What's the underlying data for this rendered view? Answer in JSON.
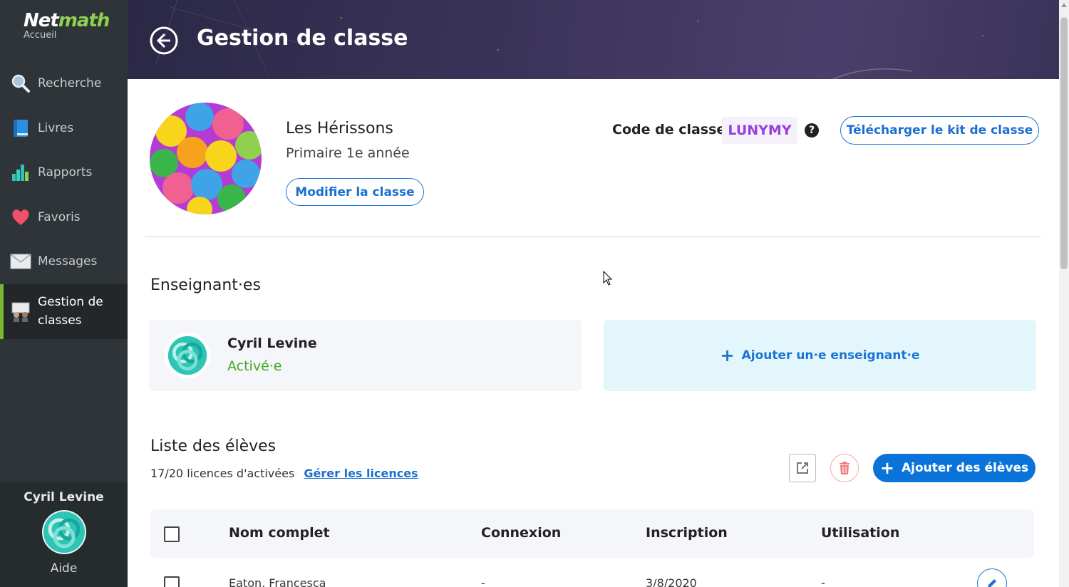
{
  "sidebar": {
    "brand_part1": "Net",
    "brand_part2": "math",
    "brand_sub": "Accueil",
    "items": [
      {
        "label": "Recherche",
        "icon": "search-icon"
      },
      {
        "label": "Livres",
        "icon": "book-icon"
      },
      {
        "label": "Rapports",
        "icon": "reports-icon"
      },
      {
        "label": "Favoris",
        "icon": "heart-icon"
      },
      {
        "label": "Messages",
        "icon": "envelope-icon"
      },
      {
        "label": "Gestion de classes",
        "icon": "class-management-icon",
        "active": true
      }
    ],
    "user_name": "Cyril Levine",
    "help_label": "Aide"
  },
  "header": {
    "title": "Gestion de classe"
  },
  "class_info": {
    "name": "Les Hérissons",
    "level": "Primaire 1e année",
    "edit_button": "Modifier la classe",
    "code_label": "Code de classe",
    "code_value": "LUNYMY",
    "help_glyph": "?",
    "download_kit_button": "Télécharger le kit de classe"
  },
  "teachers": {
    "title": "Enseignant·es",
    "list": [
      {
        "name": "Cyril Levine",
        "status": "Activé·e"
      }
    ],
    "add_button": "Ajouter un·e enseignant·e"
  },
  "students": {
    "title": "Liste des élèves",
    "licenses_text": "17/20 licences d'activées",
    "manage_licenses_link": "Gérer les licences",
    "add_button": "Ajouter des élèves",
    "columns": [
      "Nom complet",
      "Connexion",
      "Inscription",
      "Utilisation"
    ],
    "rows": [
      {
        "name": "Eaton, Francesca",
        "connexion": "-",
        "inscription": "3/8/2020",
        "utilisation": "-"
      }
    ]
  },
  "colors": {
    "sidebar_bg": "#2e3438",
    "accent_green": "#7ab833",
    "primary_blue": "#0a73d9",
    "code_purple": "#9b3fd8",
    "status_green": "#44a81b"
  }
}
